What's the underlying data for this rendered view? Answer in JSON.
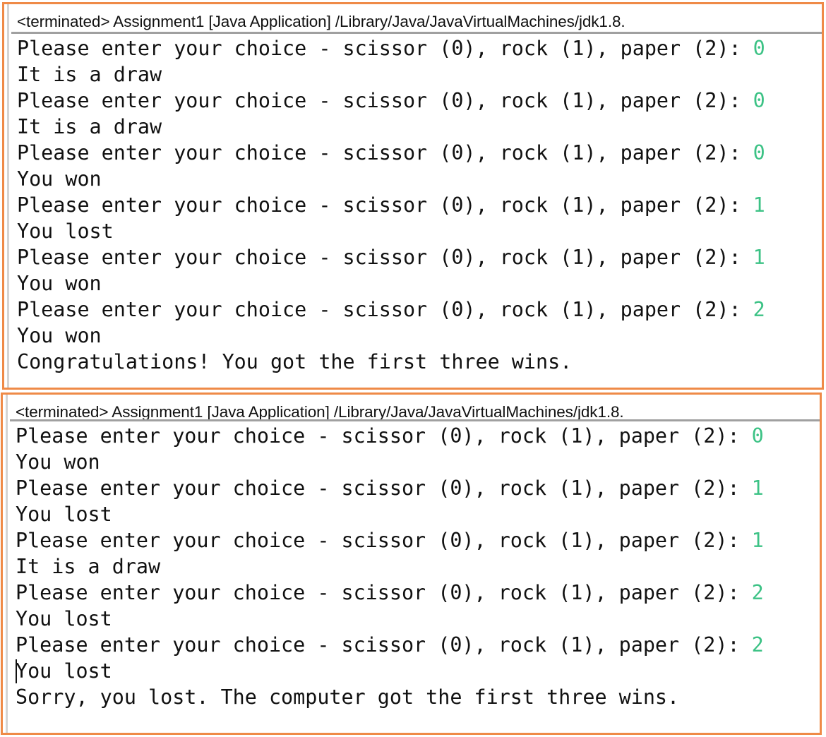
{
  "colors": {
    "panel_border": "#ef8a47",
    "stdin_text": "#3cc285",
    "stdout_text": "#111111",
    "separator": "#a0a0a0"
  },
  "panels": [
    {
      "header": "<terminated> Assignment1 [Java Application] /Library/Java/JavaVirtualMachines/jdk1.8.",
      "lines": [
        {
          "text": "Please enter your choice - scissor (0), rock (1), paper (2): ",
          "input": "0"
        },
        {
          "text": "It is a draw",
          "input": ""
        },
        {
          "text": "Please enter your choice - scissor (0), rock (1), paper (2): ",
          "input": "0"
        },
        {
          "text": "It is a draw",
          "input": ""
        },
        {
          "text": "Please enter your choice - scissor (0), rock (1), paper (2): ",
          "input": "0"
        },
        {
          "text": "You won",
          "input": ""
        },
        {
          "text": "Please enter your choice - scissor (0), rock (1), paper (2): ",
          "input": "1"
        },
        {
          "text": "You lost",
          "input": ""
        },
        {
          "text": "Please enter your choice - scissor (0), rock (1), paper (2): ",
          "input": "1"
        },
        {
          "text": "You won",
          "input": ""
        },
        {
          "text": "Please enter your choice - scissor (0), rock (1), paper (2): ",
          "input": "2"
        },
        {
          "text": "You won",
          "input": ""
        },
        {
          "text": "Congratulations! You got the first three wins.",
          "input": ""
        }
      ]
    },
    {
      "header": "<terminated> Assignment1 [Java Application] /Library/Java/JavaVirtualMachines/jdk1.8.",
      "caret_line": 9,
      "lines": [
        {
          "text": "Please enter your choice - scissor (0), rock (1), paper (2): ",
          "input": "0"
        },
        {
          "text": "You won",
          "input": ""
        },
        {
          "text": "Please enter your choice - scissor (0), rock (1), paper (2): ",
          "input": "1"
        },
        {
          "text": "You lost",
          "input": ""
        },
        {
          "text": "Please enter your choice - scissor (0), rock (1), paper (2): ",
          "input": "1"
        },
        {
          "text": "It is a draw",
          "input": ""
        },
        {
          "text": "Please enter your choice - scissor (0), rock (1), paper (2): ",
          "input": "2"
        },
        {
          "text": "You lost",
          "input": ""
        },
        {
          "text": "Please enter your choice - scissor (0), rock (1), paper (2): ",
          "input": "2"
        },
        {
          "text": "You lost",
          "input": ""
        },
        {
          "text": "Sorry, you lost. The computer got the first three wins.",
          "input": ""
        }
      ]
    }
  ]
}
